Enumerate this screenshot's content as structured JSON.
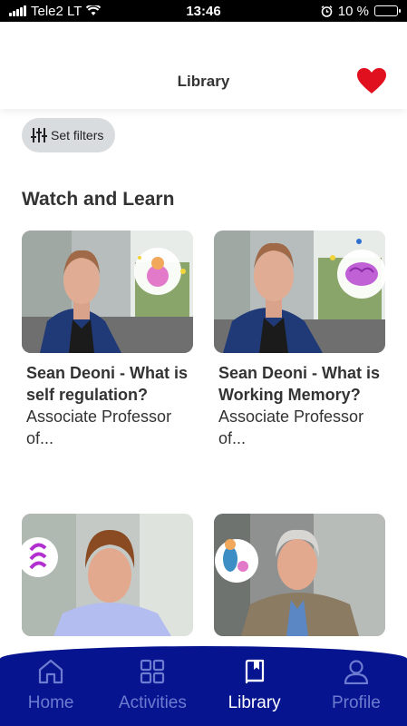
{
  "status_bar": {
    "carrier": "Tele2 LT",
    "time": "13:46",
    "battery": "10 %",
    "battery_level": 0.1
  },
  "header": {
    "title": "Library"
  },
  "filters": {
    "label": "Set filters"
  },
  "section": {
    "title": "Watch and Learn"
  },
  "cards": [
    {
      "title": "Sean Deoni - What is self regulation?",
      "subtitle": "Associate Professor of..."
    },
    {
      "title": "Sean Deoni - What is Working Memory?",
      "subtitle": "Associate Professor of..."
    },
    {
      "title": "",
      "subtitle": ""
    },
    {
      "title": "",
      "subtitle": ""
    }
  ],
  "nav": {
    "home": "Home",
    "activities": "Activities",
    "library": "Library",
    "profile": "Profile"
  },
  "colors": {
    "nav_bg": "#06148f",
    "nav_inactive": "#6d7bd0",
    "heart": "#e0101e",
    "chip_bg": "#d9dcdf"
  }
}
